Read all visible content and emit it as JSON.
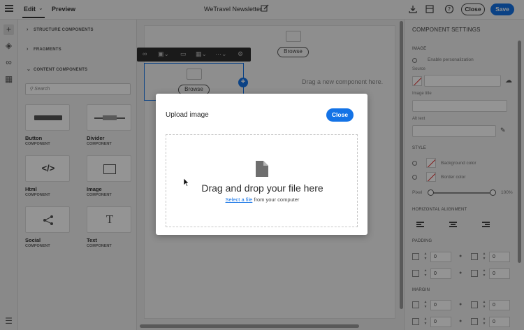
{
  "topbar": {
    "tabs": [
      "Edit",
      "Preview"
    ],
    "title": "WeTravel Newsletter",
    "close_label": "Close",
    "save_label": "Save",
    "icons": [
      "menu-icon",
      "download-icon",
      "device-preview-icon",
      "help-icon",
      "pencil-icon"
    ]
  },
  "rail": {
    "icons": [
      "add-icon",
      "layers-icon",
      "link-icon",
      "components-icon",
      "settings-bottom-icon"
    ]
  },
  "left_panel": {
    "sections": [
      "STRUCTURE COMPONENTS",
      "FRAGMENTS",
      "CONTENT COMPONENTS"
    ],
    "search_placeholder": "Search",
    "components": [
      {
        "name": "Button",
        "type": "COMPONENT"
      },
      {
        "name": "Divider",
        "type": "COMPONENT"
      },
      {
        "name": "Html",
        "type": "COMPONENT"
      },
      {
        "name": "Image",
        "type": "COMPONENT"
      },
      {
        "name": "Social",
        "type": "COMPONENT"
      },
      {
        "name": "Text",
        "type": "COMPONENT"
      }
    ]
  },
  "canvas": {
    "browse_label": "Browse",
    "drag_hint": "Drag a new component here."
  },
  "right_panel": {
    "title": "COMPONENT SETTINGS",
    "image_section": "IMAGE",
    "enable_personalization": "Enable personalization",
    "source_label": "Source",
    "image_title_label": "Image title",
    "alt_text_label": "Alt text",
    "style_section": "STYLE",
    "style_option_1": "Background color",
    "style_option_2": "Border color",
    "pixel_label": "Pixel",
    "pixel_value": "100%",
    "horizontal_alignment": "HORIZONTAL ALIGNMENT",
    "padding_section": "PADDING",
    "margin_section": "MARGIN",
    "padding_values": [
      "0",
      "0",
      "0",
      "0"
    ],
    "margin_values": [
      "0",
      "0",
      "0",
      "0"
    ]
  },
  "modal": {
    "title": "Upload image",
    "close_label": "Close",
    "drop_title": "Drag and drop your file here",
    "select_link": "Select a file",
    "select_suffix": " from your computer",
    "icon": "file-icon"
  },
  "colors": {
    "accent": "#1473e6",
    "overlay": "#000000"
  }
}
